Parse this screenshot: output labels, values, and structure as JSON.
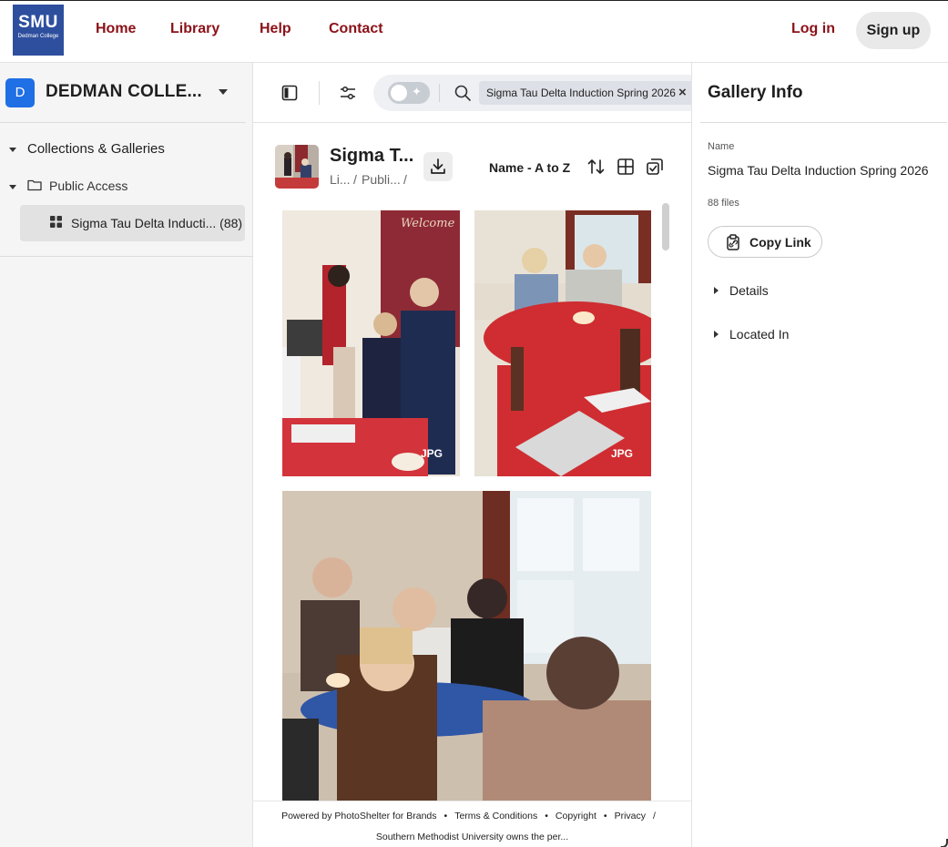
{
  "header": {
    "logo_big": "SMU",
    "logo_small": "Dedman College",
    "nav": [
      "Home",
      "Library",
      "Help",
      "Contact"
    ],
    "login": "Log in",
    "signup": "Sign up"
  },
  "sidebar": {
    "org_initial": "D",
    "org_name": "DEDMAN COLLE...",
    "tree_root": "Collections & Galleries",
    "folder": "Public Access",
    "gallery_item": "Sigma Tau Delta Inducti... (88)"
  },
  "search": {
    "chip": "Sigma Tau Delta Induction Spring 2026",
    "chip_close": "×",
    "ai_spark": "✦"
  },
  "gallery": {
    "title": "Sigma T...",
    "crumb_1": "Li...",
    "crumb_sep": "/",
    "crumb_2": "Publi...",
    "crumb_sep2": "/",
    "sort": "Name - A to Z"
  },
  "photos": [
    {
      "badge": "JPG",
      "alt": "Photo 1"
    },
    {
      "badge": "JPG",
      "alt": "Photo 2"
    },
    {
      "badge": "",
      "alt": "Photo 3"
    }
  ],
  "footer": {
    "powered": "Powered by PhotoShelter for Brands",
    "terms": "Terms & Conditions",
    "copyright": "Copyright",
    "privacy": "Privacy",
    "slash": "/",
    "dot": "•",
    "owner": "Southern Methodist University owns the per..."
  },
  "info": {
    "title": "Gallery Info",
    "name_label": "Name",
    "name_value": "Sigma Tau Delta Induction Spring 2026",
    "files": "88 files",
    "copy_link": "Copy Link",
    "details": "Details",
    "located_in": "Located In"
  },
  "colors": {
    "brand_red": "#8b1118",
    "logo_blue": "#2e4f9e",
    "accent_blue": "#1f6fe5"
  }
}
